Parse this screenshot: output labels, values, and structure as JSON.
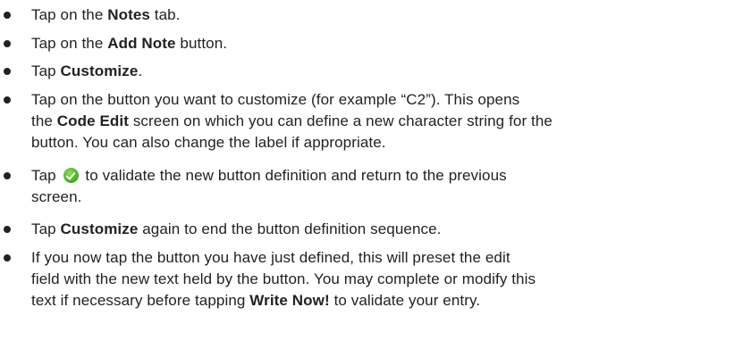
{
  "steps": [
    {
      "a": "Tap on the ",
      "b": "Notes",
      "c": " tab."
    },
    {
      "a": "Tap on the ",
      "b": "Add Note",
      "c": " button."
    },
    {
      "a": "Tap ",
      "b": "Customize",
      "c": "."
    },
    {
      "l1": "Tap on the button you want to customize (for example “C2”). This opens",
      "l2a": "the ",
      "l2b": "Code Edit",
      "l2c": " screen on which you can define a new character string for the",
      "l3": "button. You can also change the label if appropriate."
    },
    {
      "l1a": "Tap ",
      "icon": "checkmark-icon",
      "l1b": " to validate the new button definition and return to the previous",
      "l2": "screen."
    },
    {
      "a": "Tap ",
      "b": "Customize",
      "c": " again to end the button definition sequence."
    },
    {
      "l1": "If you now tap the button you have just defined, this will preset the edit",
      "l2": "field with the new text held by the button. You may complete or modify this",
      "l3a": "text if necessary before tapping ",
      "l3b": "Write Now!",
      "l3c": " to validate your entry."
    }
  ],
  "colors": {
    "text": "#222222",
    "check": "#4cb52a"
  }
}
